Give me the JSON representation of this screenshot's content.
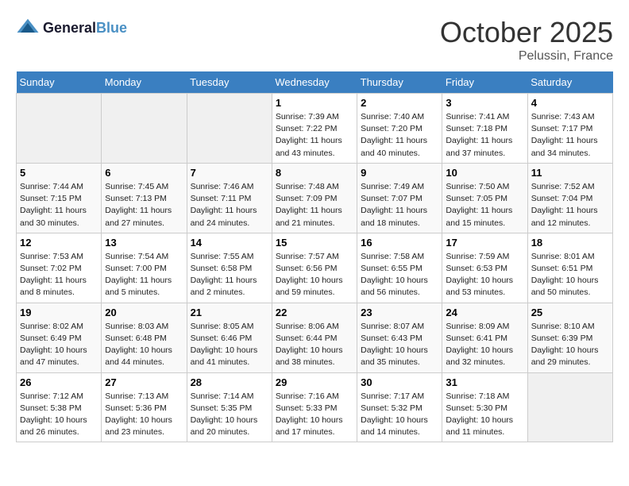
{
  "header": {
    "logo_line1": "General",
    "logo_line2": "Blue",
    "month": "October 2025",
    "location": "Pelussin, France"
  },
  "weekdays": [
    "Sunday",
    "Monday",
    "Tuesday",
    "Wednesday",
    "Thursday",
    "Friday",
    "Saturday"
  ],
  "weeks": [
    [
      {
        "day": "",
        "info": ""
      },
      {
        "day": "",
        "info": ""
      },
      {
        "day": "",
        "info": ""
      },
      {
        "day": "1",
        "info": "Sunrise: 7:39 AM\nSunset: 7:22 PM\nDaylight: 11 hours\nand 43 minutes."
      },
      {
        "day": "2",
        "info": "Sunrise: 7:40 AM\nSunset: 7:20 PM\nDaylight: 11 hours\nand 40 minutes."
      },
      {
        "day": "3",
        "info": "Sunrise: 7:41 AM\nSunset: 7:18 PM\nDaylight: 11 hours\nand 37 minutes."
      },
      {
        "day": "4",
        "info": "Sunrise: 7:43 AM\nSunset: 7:17 PM\nDaylight: 11 hours\nand 34 minutes."
      }
    ],
    [
      {
        "day": "5",
        "info": "Sunrise: 7:44 AM\nSunset: 7:15 PM\nDaylight: 11 hours\nand 30 minutes."
      },
      {
        "day": "6",
        "info": "Sunrise: 7:45 AM\nSunset: 7:13 PM\nDaylight: 11 hours\nand 27 minutes."
      },
      {
        "day": "7",
        "info": "Sunrise: 7:46 AM\nSunset: 7:11 PM\nDaylight: 11 hours\nand 24 minutes."
      },
      {
        "day": "8",
        "info": "Sunrise: 7:48 AM\nSunset: 7:09 PM\nDaylight: 11 hours\nand 21 minutes."
      },
      {
        "day": "9",
        "info": "Sunrise: 7:49 AM\nSunset: 7:07 PM\nDaylight: 11 hours\nand 18 minutes."
      },
      {
        "day": "10",
        "info": "Sunrise: 7:50 AM\nSunset: 7:05 PM\nDaylight: 11 hours\nand 15 minutes."
      },
      {
        "day": "11",
        "info": "Sunrise: 7:52 AM\nSunset: 7:04 PM\nDaylight: 11 hours\nand 12 minutes."
      }
    ],
    [
      {
        "day": "12",
        "info": "Sunrise: 7:53 AM\nSunset: 7:02 PM\nDaylight: 11 hours\nand 8 minutes."
      },
      {
        "day": "13",
        "info": "Sunrise: 7:54 AM\nSunset: 7:00 PM\nDaylight: 11 hours\nand 5 minutes."
      },
      {
        "day": "14",
        "info": "Sunrise: 7:55 AM\nSunset: 6:58 PM\nDaylight: 11 hours\nand 2 minutes."
      },
      {
        "day": "15",
        "info": "Sunrise: 7:57 AM\nSunset: 6:56 PM\nDaylight: 10 hours\nand 59 minutes."
      },
      {
        "day": "16",
        "info": "Sunrise: 7:58 AM\nSunset: 6:55 PM\nDaylight: 10 hours\nand 56 minutes."
      },
      {
        "day": "17",
        "info": "Sunrise: 7:59 AM\nSunset: 6:53 PM\nDaylight: 10 hours\nand 53 minutes."
      },
      {
        "day": "18",
        "info": "Sunrise: 8:01 AM\nSunset: 6:51 PM\nDaylight: 10 hours\nand 50 minutes."
      }
    ],
    [
      {
        "day": "19",
        "info": "Sunrise: 8:02 AM\nSunset: 6:49 PM\nDaylight: 10 hours\nand 47 minutes."
      },
      {
        "day": "20",
        "info": "Sunrise: 8:03 AM\nSunset: 6:48 PM\nDaylight: 10 hours\nand 44 minutes."
      },
      {
        "day": "21",
        "info": "Sunrise: 8:05 AM\nSunset: 6:46 PM\nDaylight: 10 hours\nand 41 minutes."
      },
      {
        "day": "22",
        "info": "Sunrise: 8:06 AM\nSunset: 6:44 PM\nDaylight: 10 hours\nand 38 minutes."
      },
      {
        "day": "23",
        "info": "Sunrise: 8:07 AM\nSunset: 6:43 PM\nDaylight: 10 hours\nand 35 minutes."
      },
      {
        "day": "24",
        "info": "Sunrise: 8:09 AM\nSunset: 6:41 PM\nDaylight: 10 hours\nand 32 minutes."
      },
      {
        "day": "25",
        "info": "Sunrise: 8:10 AM\nSunset: 6:39 PM\nDaylight: 10 hours\nand 29 minutes."
      }
    ],
    [
      {
        "day": "26",
        "info": "Sunrise: 7:12 AM\nSunset: 5:38 PM\nDaylight: 10 hours\nand 26 minutes."
      },
      {
        "day": "27",
        "info": "Sunrise: 7:13 AM\nSunset: 5:36 PM\nDaylight: 10 hours\nand 23 minutes."
      },
      {
        "day": "28",
        "info": "Sunrise: 7:14 AM\nSunset: 5:35 PM\nDaylight: 10 hours\nand 20 minutes."
      },
      {
        "day": "29",
        "info": "Sunrise: 7:16 AM\nSunset: 5:33 PM\nDaylight: 10 hours\nand 17 minutes."
      },
      {
        "day": "30",
        "info": "Sunrise: 7:17 AM\nSunset: 5:32 PM\nDaylight: 10 hours\nand 14 minutes."
      },
      {
        "day": "31",
        "info": "Sunrise: 7:18 AM\nSunset: 5:30 PM\nDaylight: 10 hours\nand 11 minutes."
      },
      {
        "day": "",
        "info": ""
      }
    ]
  ]
}
